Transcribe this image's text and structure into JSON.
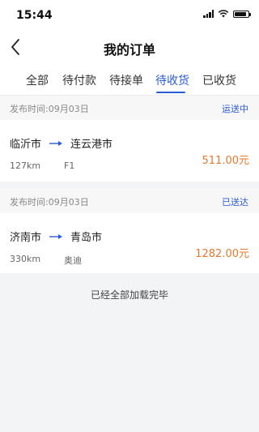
{
  "status_bar": {
    "time": "15:44"
  },
  "nav": {
    "title": "我的订单"
  },
  "tabs": [
    {
      "label": "全部"
    },
    {
      "label": "待付款"
    },
    {
      "label": "待接单"
    },
    {
      "label": "待收货",
      "active": true
    },
    {
      "label": "已收货"
    }
  ],
  "orders": [
    {
      "publish_time": "发布时间:09月03日",
      "status": "运送中",
      "from": "临沂市",
      "to": "连云港市",
      "distance": "127km",
      "car": "F1",
      "price": "511.00元"
    },
    {
      "publish_time": "发布时间:09月03日",
      "status": "已送达",
      "from": "济南市",
      "to": "青岛市",
      "distance": "330km",
      "car": "奥迪",
      "price": "1282.00元"
    }
  ],
  "footer": {
    "load_done": "已经全部加载完毕"
  },
  "colors": {
    "accent": "#2a5bd7",
    "price": "#e8792f",
    "background": "#f3f4f6"
  }
}
